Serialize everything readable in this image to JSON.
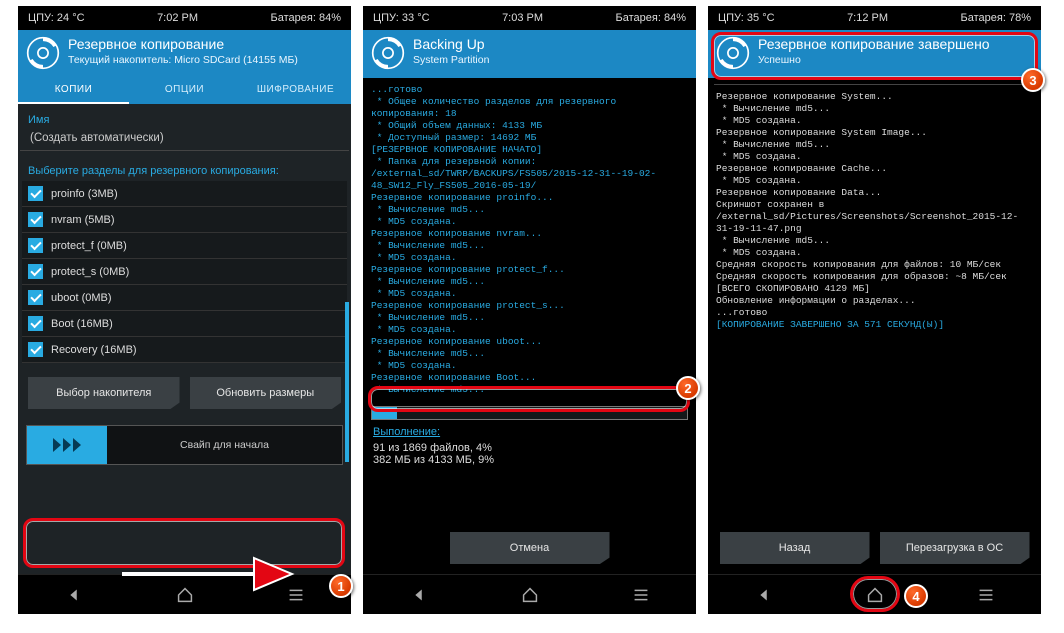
{
  "panel1": {
    "status": {
      "cpu": "ЦПУ: 24 °C",
      "time": "7:02 PM",
      "battery": "Батарея: 84%"
    },
    "header": {
      "title": "Резервное копирование",
      "subtitle": "Текущий накопитель: Micro SDCard (14155 МБ)"
    },
    "tabs": {
      "t1": "КОПИИ",
      "t2": "ОПЦИИ",
      "t3": "ШИФРОВАНИЕ"
    },
    "name_label": "Имя",
    "name_value": "(Создать автоматически)",
    "partitions_label": "Выберите разделы для резервного копирования:",
    "partitions": [
      "proinfo (3MB)",
      "nvram (5MB)",
      "protect_f (0MB)",
      "protect_s (0MB)",
      "uboot (0MB)",
      "Boot (16MB)",
      "Recovery (16MB)"
    ],
    "btn_storage": "Выбор накопителя",
    "btn_refresh": "Обновить размеры",
    "swipe_label": "Свайп для начала"
  },
  "panel2": {
    "status": {
      "cpu": "ЦПУ: 33 °C",
      "time": "7:03 PM",
      "battery": "Батарея: 84%"
    },
    "header": {
      "title": "Backing Up",
      "subtitle": "System Partition"
    },
    "log_lines": [
      "...готово",
      " * Общее количество разделов для резервного копирования: 18",
      " * Общий объем данных: 4133 МБ",
      " * Доступный размер: 14692 МБ",
      "[РЕЗЕРВНОЕ КОПИРОВАНИЕ НАЧАТО]",
      " * Папка для резервной копии: /external_sd/TWRP/BACKUPS/FS505/2015-12-31--19-02-48_SW12_Fly_FS505_2016-05-19/",
      "Резервное копирование proinfo...",
      " * Вычисление md5...",
      " * MD5 создана.",
      "Резервное копирование nvram...",
      " * Вычисление md5...",
      " * MD5 создана.",
      "Резервное копирование protect_f...",
      " * Вычисление md5...",
      " * MD5 создана.",
      "Резервное копирование protect_s...",
      " * Вычисление md5...",
      " * MD5 создана.",
      "Резервное копирование uboot...",
      " * Вычисление md5...",
      " * MD5 создана.",
      "Резервное копирование Boot...",
      " * Вычисление md5..."
    ],
    "progress_pct": 8,
    "stats_label": "Выполнение:",
    "stats_files": "91 из 1869 файлов, 4%",
    "stats_size": "382 МБ из 4133 МБ, 9%",
    "btn_cancel": "Отмена"
  },
  "panel3": {
    "status": {
      "cpu": "ЦПУ: 35 °C",
      "time": "7:12 PM",
      "battery": "Батарея: 78%"
    },
    "header": {
      "title": "Резервное копирование завершено",
      "subtitle": "Успешно"
    },
    "log_lines_white": [
      "Резервное копирование System...",
      " * Вычисление md5...",
      " * MD5 создана.",
      "Резервное копирование System Image...",
      " * Вычисление md5...",
      " * MD5 создана.",
      "Резервное копирование Cache...",
      " * MD5 создана.",
      "Резервное копирование Data...",
      "Скриншот сохранен в /external_sd/Pictures/Screenshots/Screenshot_2015-12-31-19-11-47.png",
      " * Вычисление md5...",
      " * MD5 создана.",
      "Средняя скорость копирования для файлов: 10 МБ/сек",
      "Средняя скорость копирования для образов: ~8 МБ/сек",
      "[ВСЕГО СКОПИРОВАНО 4129 МБ]",
      "Обновление информации о разделах...",
      "...готово"
    ],
    "log_done": "[КОПИРОВАНИЕ ЗАВЕРШЕНО ЗА 571 СЕКУНД(Ы)]",
    "btn_back": "Назад",
    "btn_reboot": "Перезагрузка в ОС"
  },
  "badges": {
    "b1": "1",
    "b2": "2",
    "b3": "3",
    "b4": "4"
  }
}
